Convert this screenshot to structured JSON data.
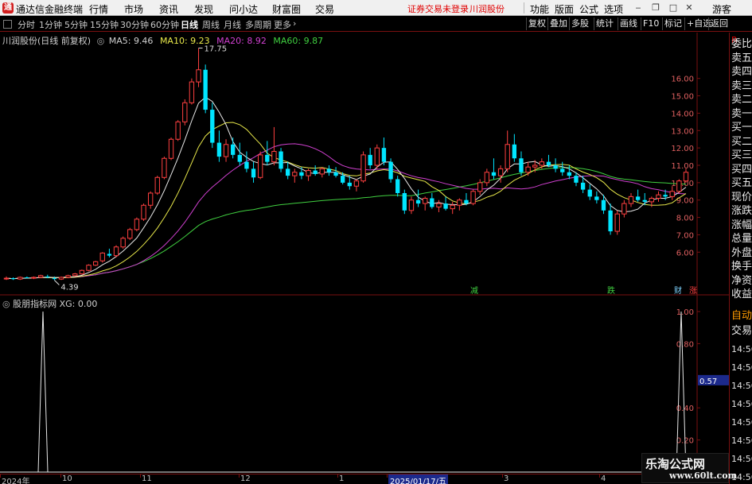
{
  "app": {
    "title": "通达信金融终端",
    "menu": [
      "行情",
      "市场",
      "资讯",
      "发现",
      "问小达",
      "财富圈",
      "交易"
    ],
    "warning": "证券交易未登录",
    "stock_title": "川润股份",
    "right_menu": [
      "功能",
      "版面",
      "公式",
      "选项"
    ],
    "user": "游客"
  },
  "toolbar": {
    "periods": [
      "分时",
      "1分钟",
      "5分钟",
      "15分钟",
      "30分钟",
      "60分钟",
      "日线",
      "周线",
      "月线",
      "多周期",
      "更多"
    ],
    "active_period": "日线",
    "right_buttons": [
      "复权",
      "叠加",
      "多股",
      "统计",
      "画线",
      "F10",
      "标记",
      "+自选",
      "返回"
    ]
  },
  "legend_main": {
    "title": "川润股份(日线 前复权)",
    "ma": [
      {
        "label": "MA5:",
        "value": "9.46",
        "color": "#e8e8e8"
      },
      {
        "label": "MA10:",
        "value": "9.23",
        "color": "#e8e84a"
      },
      {
        "label": "MA20:",
        "value": "8.92",
        "color": "#d040d0"
      },
      {
        "label": "MA60:",
        "value": "9.87",
        "color": "#40d040"
      }
    ]
  },
  "legend_ind": {
    "name": "股朋指标网",
    "xg_label": "XG:",
    "xg_value": "0.00"
  },
  "axes": {
    "price_ticks": [
      "16.00",
      "15.00",
      "14.00",
      "13.00",
      "12.00",
      "11.00",
      "10.00",
      "9.00",
      "8.00",
      "7.00",
      "6.00"
    ],
    "ind_ticks": [
      "1.00",
      "0.80",
      "0.57",
      "0.40",
      "0.20"
    ],
    "ind_highlight": "0.57",
    "date_labels": [
      "2024年",
      "10",
      "11",
      "12",
      "1",
      "2025/01/17/五",
      "3",
      "4"
    ],
    "annotations": {
      "high": "17.75",
      "low": "4.39"
    },
    "markers": [
      "减",
      "跌",
      "财",
      "涨"
    ]
  },
  "sidebar": {
    "labels": [
      "委比",
      "卖五",
      "卖四",
      "卖三",
      "卖二",
      "卖一",
      "买一",
      "买二",
      "买三",
      "买四",
      "买五",
      "现价",
      "涨跌",
      "涨幅",
      "总量",
      "外盘",
      "换手",
      "净资",
      "收益",
      "自动",
      "交易"
    ],
    "times": [
      "14:56",
      "14:56",
      "14:56",
      "14:56",
      "14:56",
      "14:56",
      "14:56",
      "14:56"
    ]
  },
  "watermark": {
    "line1": "乐淘公式网",
    "line2": "www.60lt.com"
  },
  "colors": {
    "up": "#ff4040",
    "down": "#00e5ff",
    "ma5": "#e8e8e8",
    "ma10": "#e8e84a",
    "ma20": "#d040d0",
    "ma60": "#40d040",
    "grid": "#7a1010"
  },
  "chart_data": {
    "type": "candlestick",
    "price_range": [
      4.0,
      18.0
    ],
    "high": 17.75,
    "low": 4.39,
    "candles_approx": [
      [
        4.5,
        4.6,
        4.4,
        4.5
      ],
      [
        4.5,
        4.55,
        4.4,
        4.45
      ],
      [
        4.45,
        4.6,
        4.4,
        4.55
      ],
      [
        4.55,
        4.6,
        4.5,
        4.52
      ],
      [
        4.5,
        4.6,
        4.45,
        4.55
      ],
      [
        4.55,
        4.7,
        4.5,
        4.65
      ],
      [
        4.6,
        4.7,
        4.5,
        4.55
      ],
      [
        4.5,
        4.6,
        4.39,
        4.45
      ],
      [
        4.45,
        4.6,
        4.4,
        4.55
      ],
      [
        4.55,
        4.7,
        4.5,
        4.65
      ],
      [
        4.65,
        4.8,
        4.6,
        4.75
      ],
      [
        4.75,
        5.0,
        4.7,
        4.95
      ],
      [
        4.95,
        5.3,
        4.9,
        5.25
      ],
      [
        5.25,
        5.5,
        5.2,
        5.45
      ],
      [
        5.5,
        6.0,
        5.4,
        5.95
      ],
      [
        5.9,
        6.2,
        5.7,
        5.8
      ],
      [
        5.8,
        6.4,
        5.7,
        6.3
      ],
      [
        6.3,
        6.9,
        6.2,
        6.8
      ],
      [
        6.8,
        7.4,
        6.7,
        7.3
      ],
      [
        7.3,
        8.0,
        7.2,
        7.9
      ],
      [
        7.9,
        8.8,
        7.8,
        8.7
      ],
      [
        8.7,
        9.5,
        8.5,
        9.4
      ],
      [
        9.4,
        10.4,
        9.3,
        10.3
      ],
      [
        10.3,
        11.5,
        10.2,
        11.4
      ],
      [
        11.4,
        12.6,
        11.3,
        12.5
      ],
      [
        12.5,
        13.6,
        12.4,
        13.5
      ],
      [
        13.5,
        14.8,
        13.3,
        14.6
      ],
      [
        14.6,
        16.0,
        14.5,
        15.8
      ],
      [
        15.8,
        17.75,
        15.5,
        16.5
      ],
      [
        16.5,
        16.8,
        14.0,
        14.2
      ],
      [
        14.2,
        14.6,
        12.0,
        12.3
      ],
      [
        12.3,
        13.0,
        11.2,
        11.5
      ],
      [
        11.5,
        12.5,
        11.2,
        12.2
      ],
      [
        12.2,
        12.6,
        11.4,
        11.6
      ],
      [
        11.6,
        12.3,
        11.0,
        11.2
      ],
      [
        11.2,
        11.8,
        10.6,
        10.8
      ],
      [
        10.8,
        11.2,
        10.0,
        10.3
      ],
      [
        10.3,
        11.8,
        10.2,
        11.6
      ],
      [
        11.6,
        12.4,
        11.0,
        11.2
      ],
      [
        11.2,
        13.2,
        11.0,
        11.8
      ],
      [
        11.8,
        12.0,
        10.6,
        10.8
      ],
      [
        10.8,
        11.2,
        10.2,
        10.4
      ],
      [
        10.4,
        10.8,
        10.0,
        10.6
      ],
      [
        10.6,
        10.9,
        10.2,
        10.4
      ],
      [
        10.4,
        10.8,
        10.1,
        10.7
      ],
      [
        10.7,
        11.0,
        10.4,
        10.5
      ],
      [
        10.5,
        10.9,
        10.3,
        10.8
      ],
      [
        10.8,
        11.0,
        10.4,
        10.6
      ],
      [
        10.6,
        10.9,
        10.3,
        10.4
      ],
      [
        10.4,
        10.6,
        9.9,
        10.0
      ],
      [
        10.0,
        10.4,
        9.6,
        9.8
      ],
      [
        9.8,
        10.2,
        9.5,
        10.1
      ],
      [
        10.1,
        11.8,
        10.0,
        11.6
      ],
      [
        11.6,
        12.0,
        10.8,
        11.0
      ],
      [
        11.0,
        12.2,
        10.8,
        12.0
      ],
      [
        12.0,
        12.6,
        11.0,
        11.2
      ],
      [
        11.2,
        11.4,
        10.0,
        10.2
      ],
      [
        10.2,
        10.4,
        9.2,
        9.4
      ],
      [
        9.4,
        9.6,
        8.2,
        8.4
      ],
      [
        8.4,
        9.2,
        8.2,
        9.0
      ],
      [
        9.0,
        9.6,
        8.6,
        8.8
      ],
      [
        8.8,
        9.2,
        8.4,
        9.1
      ],
      [
        9.1,
        9.4,
        8.5,
        8.6
      ],
      [
        8.6,
        9.0,
        8.3,
        8.8
      ],
      [
        8.8,
        9.2,
        8.4,
        8.5
      ],
      [
        8.5,
        8.9,
        8.2,
        8.7
      ],
      [
        8.7,
        9.1,
        8.4,
        9.0
      ],
      [
        9.0,
        9.4,
        8.7,
        8.8
      ],
      [
        8.8,
        9.6,
        8.7,
        9.5
      ],
      [
        9.5,
        10.2,
        9.3,
        10.0
      ],
      [
        10.0,
        10.8,
        9.8,
        10.6
      ],
      [
        10.6,
        11.4,
        10.2,
        10.4
      ],
      [
        10.4,
        11.0,
        10.0,
        10.8
      ],
      [
        10.8,
        13.0,
        10.6,
        12.2
      ],
      [
        12.2,
        12.8,
        11.2,
        11.4
      ],
      [
        11.4,
        11.8,
        10.4,
        10.6
      ],
      [
        10.6,
        11.2,
        10.4,
        10.9
      ],
      [
        10.9,
        11.3,
        10.6,
        11.0
      ],
      [
        11.0,
        11.4,
        10.8,
        11.2
      ],
      [
        11.2,
        11.6,
        10.9,
        11.0
      ],
      [
        11.0,
        11.4,
        10.6,
        10.8
      ],
      [
        10.8,
        11.2,
        10.4,
        10.6
      ],
      [
        10.6,
        11.0,
        10.2,
        10.4
      ],
      [
        10.4,
        10.6,
        9.8,
        10.0
      ],
      [
        10.0,
        10.4,
        9.4,
        9.6
      ],
      [
        9.6,
        9.9,
        9.0,
        9.2
      ],
      [
        9.2,
        9.5,
        8.8,
        9.0
      ],
      [
        9.0,
        9.3,
        8.2,
        8.4
      ],
      [
        8.4,
        8.8,
        7.0,
        7.2
      ],
      [
        7.2,
        8.4,
        7.0,
        8.2
      ],
      [
        8.2,
        9.0,
        8.0,
        8.8
      ],
      [
        8.8,
        9.4,
        8.6,
        9.2
      ],
      [
        9.2,
        9.6,
        8.9,
        9.0
      ],
      [
        9.0,
        9.4,
        8.7,
        8.9
      ],
      [
        8.9,
        9.2,
        8.6,
        9.1
      ],
      [
        9.1,
        9.5,
        8.9,
        9.3
      ],
      [
        9.3,
        9.6,
        9.0,
        9.2
      ],
      [
        9.2,
        9.8,
        9.0,
        9.5
      ],
      [
        9.5,
        10.2,
        9.4,
        10.1
      ],
      [
        10.1,
        10.8,
        10.0,
        10.6
      ]
    ],
    "indicator": {
      "name": "XG",
      "range": [
        0,
        1.0
      ],
      "spikes_at_candle_index": [
        8,
        98
      ],
      "last_value": 0.0
    }
  }
}
